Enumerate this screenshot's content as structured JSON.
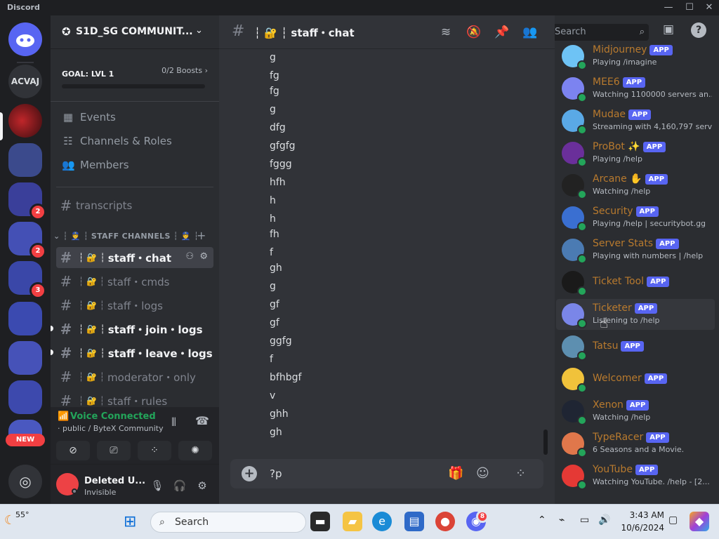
{
  "window": {
    "app_name": "Discord"
  },
  "rail": {
    "server_initials": "ACVAJ",
    "new_label": "NEW",
    "badges": [
      "2",
      "2",
      "3"
    ]
  },
  "sidebar": {
    "server_name": "S1D_SG COMMUNIT...",
    "goal_label": "GOAL: LVL 1",
    "boosts": "0/2 Boosts",
    "nav": [
      "Events",
      "Channels & Roles",
      "Members"
    ],
    "transcripts": "transcripts",
    "category": "┆ 👮 ┆ STAFF CHANNELS ┆ 👮 ┆",
    "channels": [
      {
        "prefix": "┆ 🔐 ┆",
        "name": "staff・chat"
      },
      {
        "prefix": "┆ 🔐 ┆",
        "name": "staff・cmds"
      },
      {
        "prefix": "┆ 🔐 ┆",
        "name": "staff・logs"
      },
      {
        "prefix": "┆ 🔐 ┆",
        "name": "staff・join・logs"
      },
      {
        "prefix": "┆ 🔐 ┆",
        "name": "staff・leave・logs"
      },
      {
        "prefix": "┆ 🔐 ┆",
        "name": "moderator・only"
      },
      {
        "prefix": "┆ 🔐 ┆",
        "name": "staff・rules"
      }
    ],
    "voice_status": "Voice Connected",
    "voice_channel": "public / ByteX Community",
    "username": "Deleted U...",
    "user_status": "Invisible"
  },
  "chat": {
    "title": "┆ 🔐 ┆ staff・chat",
    "messages": [
      "g",
      "fg",
      "fg",
      "g",
      "dfg",
      "gfgfg",
      "fggg",
      "hfh",
      "h",
      "h",
      "fh",
      "f",
      "gh",
      "g",
      "gf",
      "gf",
      "ggfg",
      "f",
      "bfhbgf",
      "v",
      "ghh",
      "gh"
    ],
    "composer_value": "?p"
  },
  "members": {
    "search_placeholder": "Search",
    "app_tag": "APP",
    "list": [
      {
        "name": "Midjourney",
        "activity": "Playing /imagine",
        "color": "#6ec3f5"
      },
      {
        "name": "MEE6",
        "activity": "Watching 1100000 servers an...",
        "color": "#7c83f0"
      },
      {
        "name": "Mudae",
        "activity": "Streaming with 4,160,797 serv...",
        "color": "#5aa9e6"
      },
      {
        "name": "ProBot ✨",
        "activity": "Playing /help",
        "color": "#6a2f9a"
      },
      {
        "name": "Arcane ✋",
        "activity": "Watching /help",
        "color": "#222222"
      },
      {
        "name": "Security",
        "activity": "Playing /help | securitybot.gg",
        "color": "#3a6fd1"
      },
      {
        "name": "Server Stats",
        "activity": "Playing with numbers | /help",
        "color": "#4b7bb3"
      },
      {
        "name": "Ticket Tool",
        "activity": "",
        "color": "#1a1a1a"
      },
      {
        "name": "Ticketer",
        "activity": "Listening to /help",
        "color": "#7a86e8"
      },
      {
        "name": "Tatsu",
        "activity": "",
        "color": "#5d8fb0"
      },
      {
        "name": "Welcomer",
        "activity": "",
        "color": "#f0c23b"
      },
      {
        "name": "Xenon",
        "activity": "Watching /help",
        "color": "#1f2533"
      },
      {
        "name": "TypeRacer",
        "activity": "6 Seasons and a Movie.",
        "color": "#e0774b"
      },
      {
        "name": "YouTube",
        "activity": "Watching YouTube. /help - [2...",
        "color": "#e53935"
      }
    ]
  },
  "taskbar": {
    "temp": "55°",
    "search": "Search",
    "time": "3:43 AM",
    "date": "10/6/2024",
    "discord_badge": "8"
  }
}
